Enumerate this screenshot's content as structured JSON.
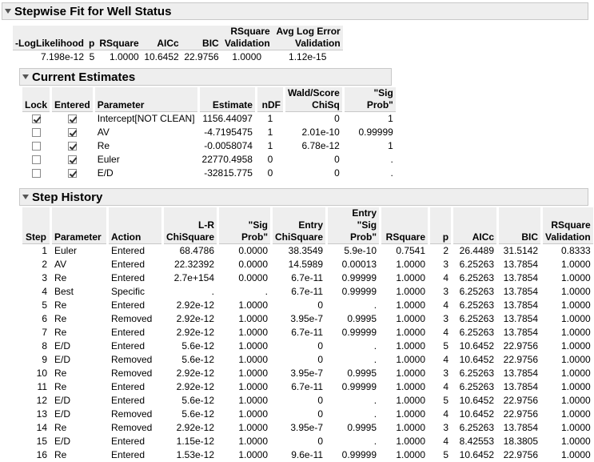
{
  "title": "Stepwise Fit for Well Status",
  "summary": {
    "headers": [
      "-LogLikelihood",
      "p",
      "RSquare",
      "AICc",
      "BIC",
      "RSquare Validation",
      "Avg Log Error Validation"
    ],
    "row": [
      "7.198e-12",
      "5",
      "1.0000",
      "10.6452",
      "22.9756",
      "1.0000",
      "1.12e-15"
    ]
  },
  "estimates": {
    "title": "Current Estimates",
    "headers": [
      "Lock",
      "Entered",
      "Parameter",
      "Estimate",
      "nDF",
      "Wald/Score ChiSq",
      "\"Sig Prob\""
    ],
    "rows": [
      {
        "lock": true,
        "entered": true,
        "parameter": "Intercept[NOT CLEAN]",
        "estimate": "1156.44097",
        "ndf": "1",
        "chisq": "0",
        "sigprob": "1"
      },
      {
        "lock": false,
        "entered": true,
        "parameter": "AV",
        "estimate": "-4.7195475",
        "ndf": "1",
        "chisq": "2.01e-10",
        "sigprob": "0.99999"
      },
      {
        "lock": false,
        "entered": true,
        "parameter": "Re",
        "estimate": "-0.0058074",
        "ndf": "1",
        "chisq": "6.78e-12",
        "sigprob": "1"
      },
      {
        "lock": false,
        "entered": true,
        "parameter": "Euler",
        "estimate": "22770.4958",
        "ndf": "0",
        "chisq": "0",
        "sigprob": "."
      },
      {
        "lock": false,
        "entered": true,
        "parameter": "E/D",
        "estimate": "-32815.775",
        "ndf": "0",
        "chisq": "0",
        "sigprob": "."
      }
    ]
  },
  "history": {
    "title": "Step History",
    "headers": [
      "Step",
      "Parameter",
      "Action",
      "L-R ChiSquare",
      "\"Sig Prob\"",
      "Entry ChiSquare",
      "Entry \"Sig Prob\"",
      "RSquare",
      "p",
      "AICc",
      "BIC",
      "RSquare Validation"
    ],
    "rows": [
      [
        "1",
        "Euler",
        "Entered",
        "68.4786",
        "0.0000",
        "38.3549",
        "5.9e-10",
        "0.7541",
        "2",
        "26.4489",
        "31.5142",
        "0.8333"
      ],
      [
        "2",
        "AV",
        "Entered",
        "22.32392",
        "0.0000",
        "14.5989",
        "0.00013",
        "1.0000",
        "3",
        "6.25263",
        "13.7854",
        "1.0000"
      ],
      [
        "3",
        "Re",
        "Entered",
        "2.7e+154",
        "0.0000",
        "6.7e-11",
        "0.99999",
        "1.0000",
        "4",
        "6.25263",
        "13.7854",
        "1.0000"
      ],
      [
        "4",
        "Best",
        "Specific",
        ".",
        ".",
        "6.7e-11",
        "0.99999",
        "1.0000",
        "3",
        "6.25263",
        "13.7854",
        "1.0000"
      ],
      [
        "5",
        "Re",
        "Entered",
        "2.92e-12",
        "1.0000",
        "0",
        ".",
        "1.0000",
        "4",
        "6.25263",
        "13.7854",
        "1.0000"
      ],
      [
        "6",
        "Re",
        "Removed",
        "2.92e-12",
        "1.0000",
        "3.95e-7",
        "0.9995",
        "1.0000",
        "3",
        "6.25263",
        "13.7854",
        "1.0000"
      ],
      [
        "7",
        "Re",
        "Entered",
        "2.92e-12",
        "1.0000",
        "6.7e-11",
        "0.99999",
        "1.0000",
        "4",
        "6.25263",
        "13.7854",
        "1.0000"
      ],
      [
        "8",
        "E/D",
        "Entered",
        "5.6e-12",
        "1.0000",
        "0",
        ".",
        "1.0000",
        "5",
        "10.6452",
        "22.9756",
        "1.0000"
      ],
      [
        "9",
        "E/D",
        "Removed",
        "5.6e-12",
        "1.0000",
        "0",
        ".",
        "1.0000",
        "4",
        "10.6452",
        "22.9756",
        "1.0000"
      ],
      [
        "10",
        "Re",
        "Removed",
        "2.92e-12",
        "1.0000",
        "3.95e-7",
        "0.9995",
        "1.0000",
        "3",
        "6.25263",
        "13.7854",
        "1.0000"
      ],
      [
        "11",
        "Re",
        "Entered",
        "2.92e-12",
        "1.0000",
        "6.7e-11",
        "0.99999",
        "1.0000",
        "4",
        "6.25263",
        "13.7854",
        "1.0000"
      ],
      [
        "12",
        "E/D",
        "Entered",
        "5.6e-12",
        "1.0000",
        "0",
        ".",
        "1.0000",
        "5",
        "10.6452",
        "22.9756",
        "1.0000"
      ],
      [
        "13",
        "E/D",
        "Removed",
        "5.6e-12",
        "1.0000",
        "0",
        ".",
        "1.0000",
        "4",
        "10.6452",
        "22.9756",
        "1.0000"
      ],
      [
        "14",
        "Re",
        "Removed",
        "2.92e-12",
        "1.0000",
        "3.95e-7",
        "0.9995",
        "1.0000",
        "3",
        "6.25263",
        "13.7854",
        "1.0000"
      ],
      [
        "15",
        "E/D",
        "Entered",
        "1.15e-12",
        "1.0000",
        "0",
        ".",
        "1.0000",
        "4",
        "8.42553",
        "18.3805",
        "1.0000"
      ],
      [
        "16",
        "Re",
        "Entered",
        "1.53e-12",
        "1.0000",
        "9.6e-11",
        "0.99999",
        "1.0000",
        "5",
        "10.6452",
        "22.9756",
        "1.0000"
      ]
    ]
  }
}
